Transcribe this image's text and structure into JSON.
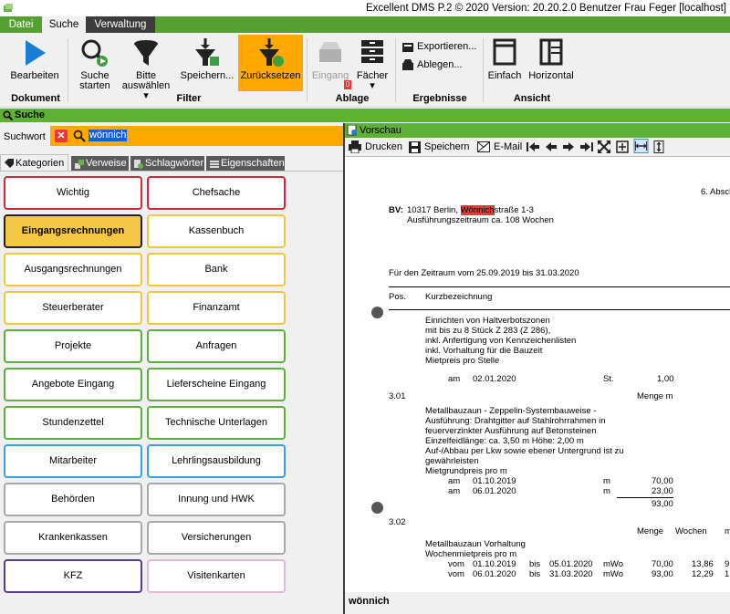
{
  "window": {
    "title": "Excellent DMS P.2 © 2020 Version: 20.20.2.0 Benutzer Frau Feger  [localhost]"
  },
  "menu_tabs": [
    {
      "label": "Datei"
    },
    {
      "label": "Suche"
    },
    {
      "label": "Verwaltung"
    }
  ],
  "ribbon": {
    "bearbeiten": "Bearbeiten",
    "suche_starten_1": "Suche",
    "suche_starten_2": "starten",
    "bitte_1": "Bitte",
    "bitte_2": "auswählen ▾",
    "speichern": "Speichern...",
    "zuruecksetzen": "Zurücksetzen",
    "eingang": "Eingang",
    "eingang_badge": "0",
    "faecher_1": "Fächer",
    "faecher_2": "▾",
    "exportieren": "Exportieren...",
    "ablegen": "Ablegen...",
    "einfach": "Einfach",
    "horizontal": "Horizontal",
    "groups": {
      "dokument": "Dokument",
      "filter": "Filter",
      "ablage": "Ablage",
      "ergebnisse": "Ergebnisse",
      "ansicht": "Ansicht"
    }
  },
  "search_header": "Suche",
  "suchwort": {
    "label": "Suchwort",
    "value": "wönnich"
  },
  "category_tabs": [
    {
      "label": "Kategorien"
    },
    {
      "label": "Verweise"
    },
    {
      "label": "Schlagwörter"
    },
    {
      "label": "Eigenschaften"
    }
  ],
  "categories": [
    {
      "label": "Wichtig",
      "color": "#d2283a"
    },
    {
      "label": "Chefsache",
      "color": "#d2283a"
    },
    {
      "label": "Eingangsrechnungen",
      "color": "#222222",
      "selected": true
    },
    {
      "label": "Kassenbuch",
      "color": "#f0c840"
    },
    {
      "label": "Ausgangsrechnungen",
      "color": "#f0c840"
    },
    {
      "label": "Bank",
      "color": "#f0c840"
    },
    {
      "label": "Steuerberater",
      "color": "#f0c840"
    },
    {
      "label": "Finanzamt",
      "color": "#f0c840"
    },
    {
      "label": "Projekte",
      "color": "#5cb040"
    },
    {
      "label": "Anfragen",
      "color": "#5cb040"
    },
    {
      "label": "Angebote Eingang",
      "color": "#5cb040"
    },
    {
      "label": "Lieferscheine Eingang",
      "color": "#5cb040"
    },
    {
      "label": "Stundenzettel",
      "color": "#5cb040"
    },
    {
      "label": "Technische Unterlagen",
      "color": "#5cb040"
    },
    {
      "label": "Mitarbeiter",
      "color": "#3aa0e0"
    },
    {
      "label": "Lehrlingsausbildung",
      "color": "#3aa0e0"
    },
    {
      "label": "Behörden",
      "color": "#a8a8a8"
    },
    {
      "label": "Innung und HWK",
      "color": "#a8a8a8"
    },
    {
      "label": "Krankenkassen",
      "color": "#a8a8a8"
    },
    {
      "label": "Versicherungen",
      "color": "#a8a8a8"
    },
    {
      "label": "KFZ",
      "color": "#5a3a8a"
    },
    {
      "label": "Visitenkarten",
      "color": "#e0b8d8"
    }
  ],
  "preview": {
    "header": "Vorschau",
    "toolbar": {
      "drucken": "Drucken",
      "speichern": "Speichern",
      "email": "E-Mail"
    },
    "footer": "wönnich",
    "doc": {
      "top_right": "6. Abscl",
      "bv_label": "BV:",
      "bv_pre": "10317 Berlin, ",
      "bv_hl": "Wönnich",
      "bv_post": "straße 1-3",
      "ausf": "Ausführungszeitraum ca. 108 Wochen",
      "zeitraum": "Für den Zeitraum vom 25.09.2019 bis 31.03.2020",
      "pos": "Pos.",
      "kurz": "Kurzbezeichnung",
      "l1": "Einrichten von Haltverbotszonen",
      "l2": "mit bis zu 8 Stück Z 283 (Z 286),",
      "l3": "inkl. Anfertigung von Kennzeichenlisten",
      "l4": "inkl. Vorhaltung für die Bauzeit",
      "l5": "Mietpreis pro Stelle",
      "am1": "am",
      "am1d": "02.01.2020",
      "st": "St.",
      "st_v": "1,00",
      "p301": "3.01",
      "menge1": "Menge   m",
      "m1": "Metallbauzaun - Zeppelin-Systembauweise -",
      "m2": "Ausführung: Drahtgitter auf Stahlrohrrahmen in",
      "m3": "feuerverzinkter Ausführung auf Betonsteinen",
      "m4": "Einzelfeidlänge: ca. 3,50 m Höhe: 2,00 m",
      "m5": "Auf-/Abbau per Lkw sowie ebener Untergrund ist zu",
      "m6": "gewährleisten",
      "m7": "Mietgrundpreis pro m",
      "am2": "am",
      "am2d": "01.10.2019",
      "m_u1": "m",
      "v1": "70,00",
      "am3": "am",
      "am3d": "06.01.2020",
      "m_u2": "m",
      "v2": "23,00",
      "sum": "93,00",
      "p302": "3.02",
      "menge2": "Menge",
      "wochen": "Wochen",
      "mcut": "m",
      "z1": "Metallbauzaun Vorhaltung",
      "z2": "Wochenmietpreis pro m",
      "vom1": "vom",
      "vom1d": "01.10.2019",
      "bis1": "bis",
      "bis1d": "05.01.2020",
      "mwo1": "mWo",
      "q1": "70,00",
      "w1": "13,86",
      "c1": "9",
      "vom2": "vom",
      "vom2d": "06.01.2020",
      "bis2": "bis",
      "bis2d": "31.03.2020",
      "mwo2": "mWo",
      "q2": "93,00",
      "w2": "12,29",
      "c2": "1"
    }
  }
}
